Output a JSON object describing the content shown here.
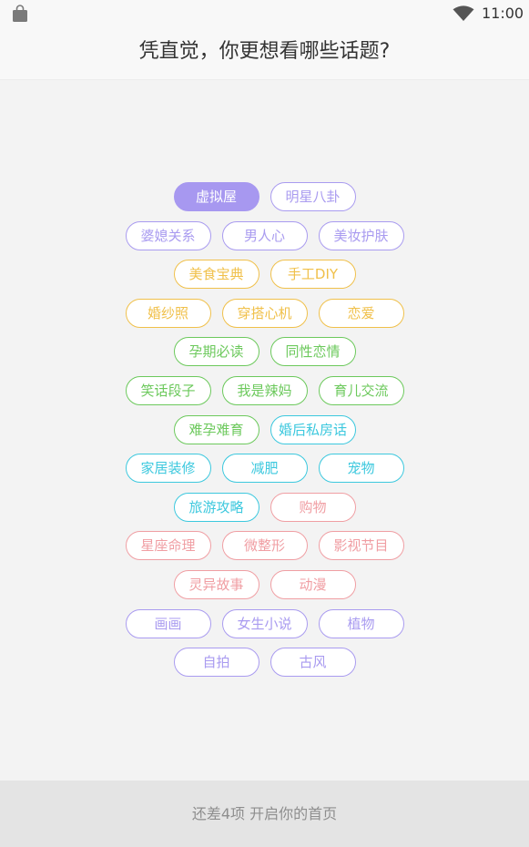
{
  "status_bar": {
    "time": "11:00",
    "left_icon": "shopping-bag-icon",
    "right_icon": "wifi-icon"
  },
  "header": {
    "title": "凭直觉，你更想看哪些话题?"
  },
  "colors": {
    "purple": "#a99bf0",
    "orange": "#f0c04a",
    "green": "#6cc95c",
    "cyan": "#3cc8de",
    "pink": "#f09ea3",
    "selected_fill": "#a798f0"
  },
  "tag_rows": [
    [
      {
        "label": "虚拟屋",
        "color": "purple",
        "selected": true
      },
      {
        "label": "明星八卦",
        "color": "purple",
        "selected": false
      }
    ],
    [
      {
        "label": "婆媳关系",
        "color": "purple",
        "selected": false
      },
      {
        "label": "男人心",
        "color": "purple",
        "selected": false
      },
      {
        "label": "美妆护肤",
        "color": "purple",
        "selected": false
      }
    ],
    [
      {
        "label": "美食宝典",
        "color": "orange",
        "selected": false
      },
      {
        "label": "手工DIY",
        "color": "orange",
        "selected": false
      }
    ],
    [
      {
        "label": "婚纱照",
        "color": "orange",
        "selected": false
      },
      {
        "label": "穿搭心机",
        "color": "orange",
        "selected": false
      },
      {
        "label": "恋爱",
        "color": "orange",
        "selected": false
      }
    ],
    [
      {
        "label": "孕期必读",
        "color": "green",
        "selected": false
      },
      {
        "label": "同性恋情",
        "color": "green",
        "selected": false
      }
    ],
    [
      {
        "label": "笑话段子",
        "color": "green",
        "selected": false
      },
      {
        "label": "我是辣妈",
        "color": "green",
        "selected": false
      },
      {
        "label": "育儿交流",
        "color": "green",
        "selected": false
      }
    ],
    [
      {
        "label": "难孕难育",
        "color": "green",
        "selected": false
      },
      {
        "label": "婚后私房话",
        "color": "cyan",
        "selected": false
      }
    ],
    [
      {
        "label": "家居装修",
        "color": "cyan",
        "selected": false
      },
      {
        "label": "减肥",
        "color": "cyan",
        "selected": false
      },
      {
        "label": "宠物",
        "color": "cyan",
        "selected": false
      }
    ],
    [
      {
        "label": "旅游攻略",
        "color": "cyan",
        "selected": false
      },
      {
        "label": "购物",
        "color": "pink",
        "selected": false
      }
    ],
    [
      {
        "label": "星座命理",
        "color": "pink",
        "selected": false
      },
      {
        "label": "微整形",
        "color": "pink",
        "selected": false
      },
      {
        "label": "影视节目",
        "color": "pink",
        "selected": false
      }
    ],
    [
      {
        "label": "灵异故事",
        "color": "pink",
        "selected": false
      },
      {
        "label": "动漫",
        "color": "pink",
        "selected": false
      }
    ],
    [
      {
        "label": "画画",
        "color": "purple",
        "selected": false
      },
      {
        "label": "女生小说",
        "color": "purple",
        "selected": false
      },
      {
        "label": "植物",
        "color": "purple",
        "selected": false
      }
    ],
    [
      {
        "label": "自拍",
        "color": "purple",
        "selected": false
      },
      {
        "label": "古风",
        "color": "purple",
        "selected": false
      }
    ]
  ],
  "footer": {
    "label": "还差4项 开启你的首页"
  }
}
